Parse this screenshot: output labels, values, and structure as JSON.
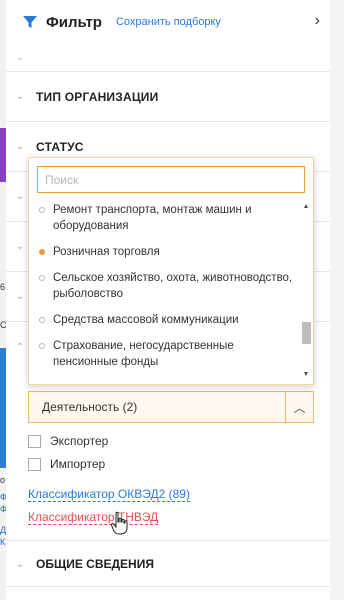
{
  "header": {
    "title": "Фильтр",
    "save_label": "Сохранить подборку",
    "accent": "#2d7ad6"
  },
  "sections": [
    {
      "title": "ТИП ОРГАНИЗАЦИИ"
    },
    {
      "title": "СТАТУС"
    }
  ],
  "dropdown": {
    "search_placeholder": "Поиск",
    "items": [
      {
        "label": "Ремонт транспорта, монтаж машин и оборудования",
        "selected": false
      },
      {
        "label": "Розничная торговля",
        "selected": true
      },
      {
        "label": "Сельское хозяйство, охота, животноводство, рыболовство",
        "selected": false
      },
      {
        "label": "Средства массовой коммуникации",
        "selected": false
      },
      {
        "label": "Страхование, негосударственные пенсионные фонды",
        "selected": false
      }
    ]
  },
  "activity_select": {
    "label": "Деятельность  (2)"
  },
  "checkboxes": [
    {
      "label": "Экспортер"
    },
    {
      "label": "Импортер"
    }
  ],
  "links": {
    "okved": "Классификатор ОКВЭД2 (89)",
    "tnved": "Классификатор ТНВЭД"
  },
  "bottom_section": {
    "title": "ОБЩИЕ СВЕДЕНИЯ"
  },
  "left_fragments": [
    "6",
    "С",
    "о",
    "Ф",
    "Ф",
    "Д",
    "К"
  ],
  "colors": {
    "selected_dot": "#f29a3a",
    "link_blue": "#2d7ad6",
    "link_red": "#e05050"
  }
}
